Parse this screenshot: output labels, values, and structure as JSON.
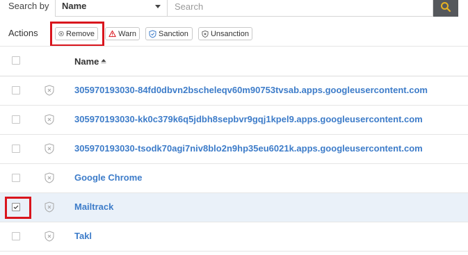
{
  "search": {
    "label": "Search by",
    "field_value": "Name",
    "placeholder": "Search",
    "button_icon": "search-icon"
  },
  "actions": {
    "label": "Actions",
    "buttons": [
      {
        "label": "Remove",
        "icon": "remove-circle-icon"
      },
      {
        "label": "Warn",
        "icon": "warning-triangle-icon"
      },
      {
        "label": "Sanction",
        "icon": "shield-check-icon"
      },
      {
        "label": "Unsanction",
        "icon": "shield-x-icon"
      }
    ]
  },
  "table": {
    "column_name": "Name",
    "sort": "ascending",
    "rows": [
      {
        "name": "305970193030-84fd0dbvn2bscheleqv60m90753tvsab.apps.googleusercontent.com",
        "checked": false
      },
      {
        "name": "305970193030-kk0c379k6q5jdbh8sepbvr9gqj1kpel9.apps.googleusercontent.com",
        "checked": false
      },
      {
        "name": "305970193030-tsodk70agi7niv8blo2n9hp35eu6021k.apps.googleusercontent.com",
        "checked": false
      },
      {
        "name": "Google Chrome",
        "checked": false
      },
      {
        "name": "Mailtrack",
        "checked": true
      },
      {
        "name": "Takl",
        "checked": false
      }
    ]
  },
  "colors": {
    "link": "#3d7cc9",
    "highlight": "#d9151d",
    "selected_row": "#eaf1f9",
    "search_button": "#55585c",
    "search_icon": "#e8b321"
  }
}
